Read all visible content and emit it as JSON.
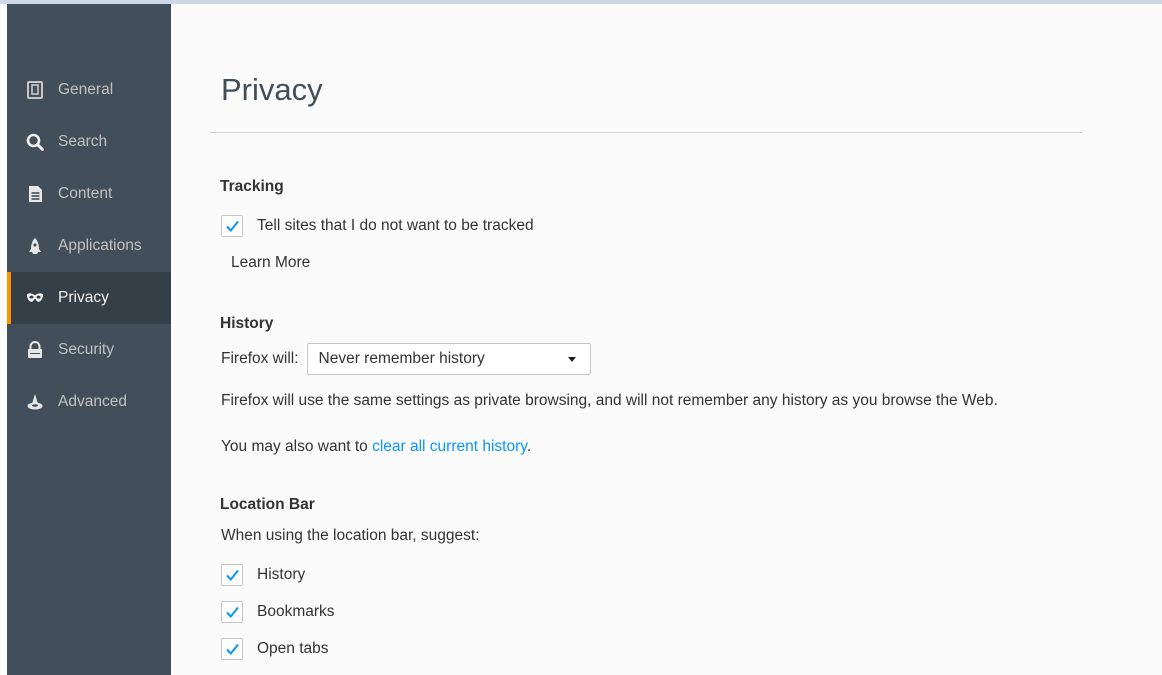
{
  "sidebar": {
    "items": [
      {
        "label": "General",
        "icon": "general-icon"
      },
      {
        "label": "Search",
        "icon": "search-icon"
      },
      {
        "label": "Content",
        "icon": "content-icon"
      },
      {
        "label": "Applications",
        "icon": "applications-icon"
      },
      {
        "label": "Privacy",
        "icon": "privacy-mask-icon",
        "selected": true
      },
      {
        "label": "Security",
        "icon": "security-lock-icon"
      },
      {
        "label": "Advanced",
        "icon": "advanced-wizard-icon"
      }
    ]
  },
  "main": {
    "title": "Privacy",
    "tracking": {
      "heading": "Tracking",
      "dnt_label": "Tell sites that I do not want to be tracked",
      "dnt_checked": true,
      "learn_more": "Learn More"
    },
    "history": {
      "heading": "History",
      "will_label": "Firefox will:",
      "will_value": "Never remember history",
      "description": "Firefox will use the same settings as private browsing, and will not remember any history as you browse the Web.",
      "clear_prefix": "You may also want to ",
      "clear_link": "clear all current history",
      "clear_suffix": "."
    },
    "location_bar": {
      "heading": "Location Bar",
      "suggest_label": "When using the location bar, suggest:",
      "options": [
        {
          "label": "History",
          "checked": true
        },
        {
          "label": "Bookmarks",
          "checked": true
        },
        {
          "label": "Open tabs",
          "checked": true
        }
      ]
    }
  },
  "colors": {
    "sidebar_bg": "#424f5a",
    "sidebar_selected_bg": "#343f48",
    "selected_accent": "#ff9500",
    "link": "#0996f8",
    "checkmark": "#0996f8"
  }
}
